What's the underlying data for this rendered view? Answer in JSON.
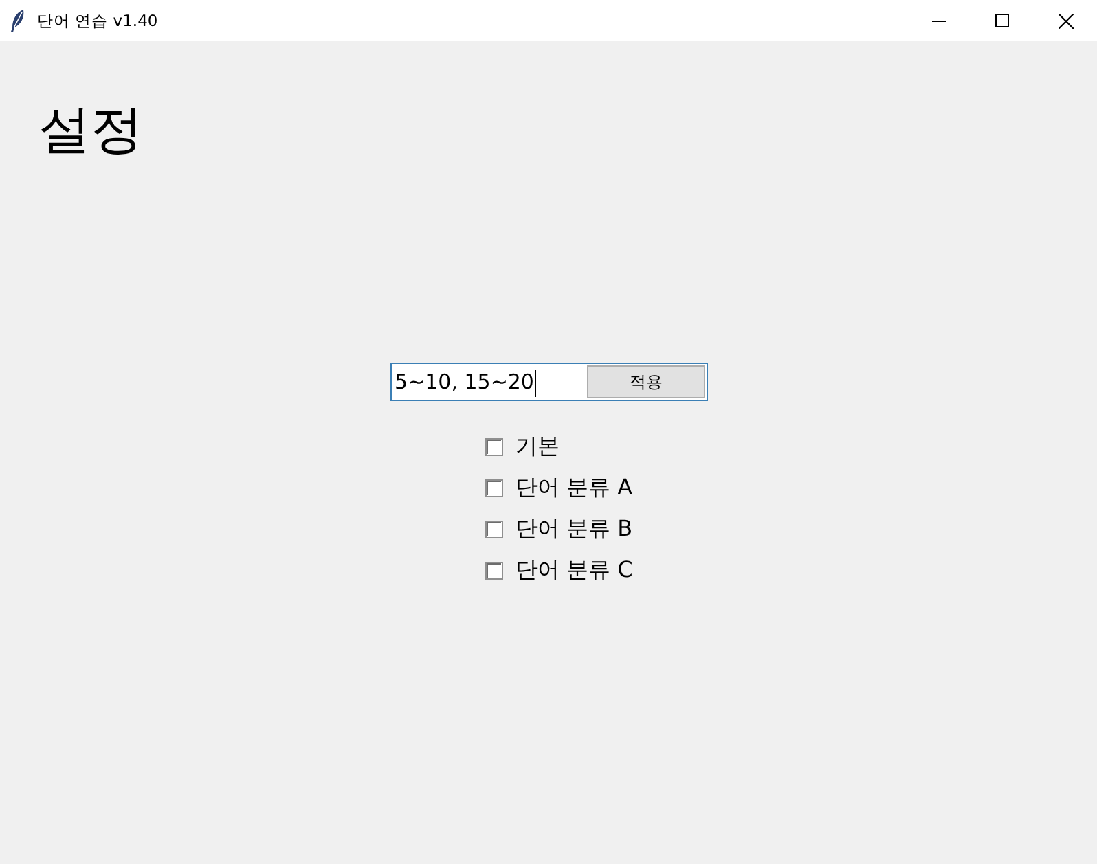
{
  "window": {
    "title": "단어 연습 v1.40"
  },
  "heading": "설정",
  "range_input": {
    "value": "5~10, 15~20",
    "focused": true
  },
  "apply_button": {
    "label": "적용"
  },
  "categories": [
    {
      "label": "기본",
      "checked": false
    },
    {
      "label": "단어 분류 A",
      "checked": false
    },
    {
      "label": "단어 분류 B",
      "checked": false
    },
    {
      "label": "단어 분류 C",
      "checked": false
    }
  ]
}
